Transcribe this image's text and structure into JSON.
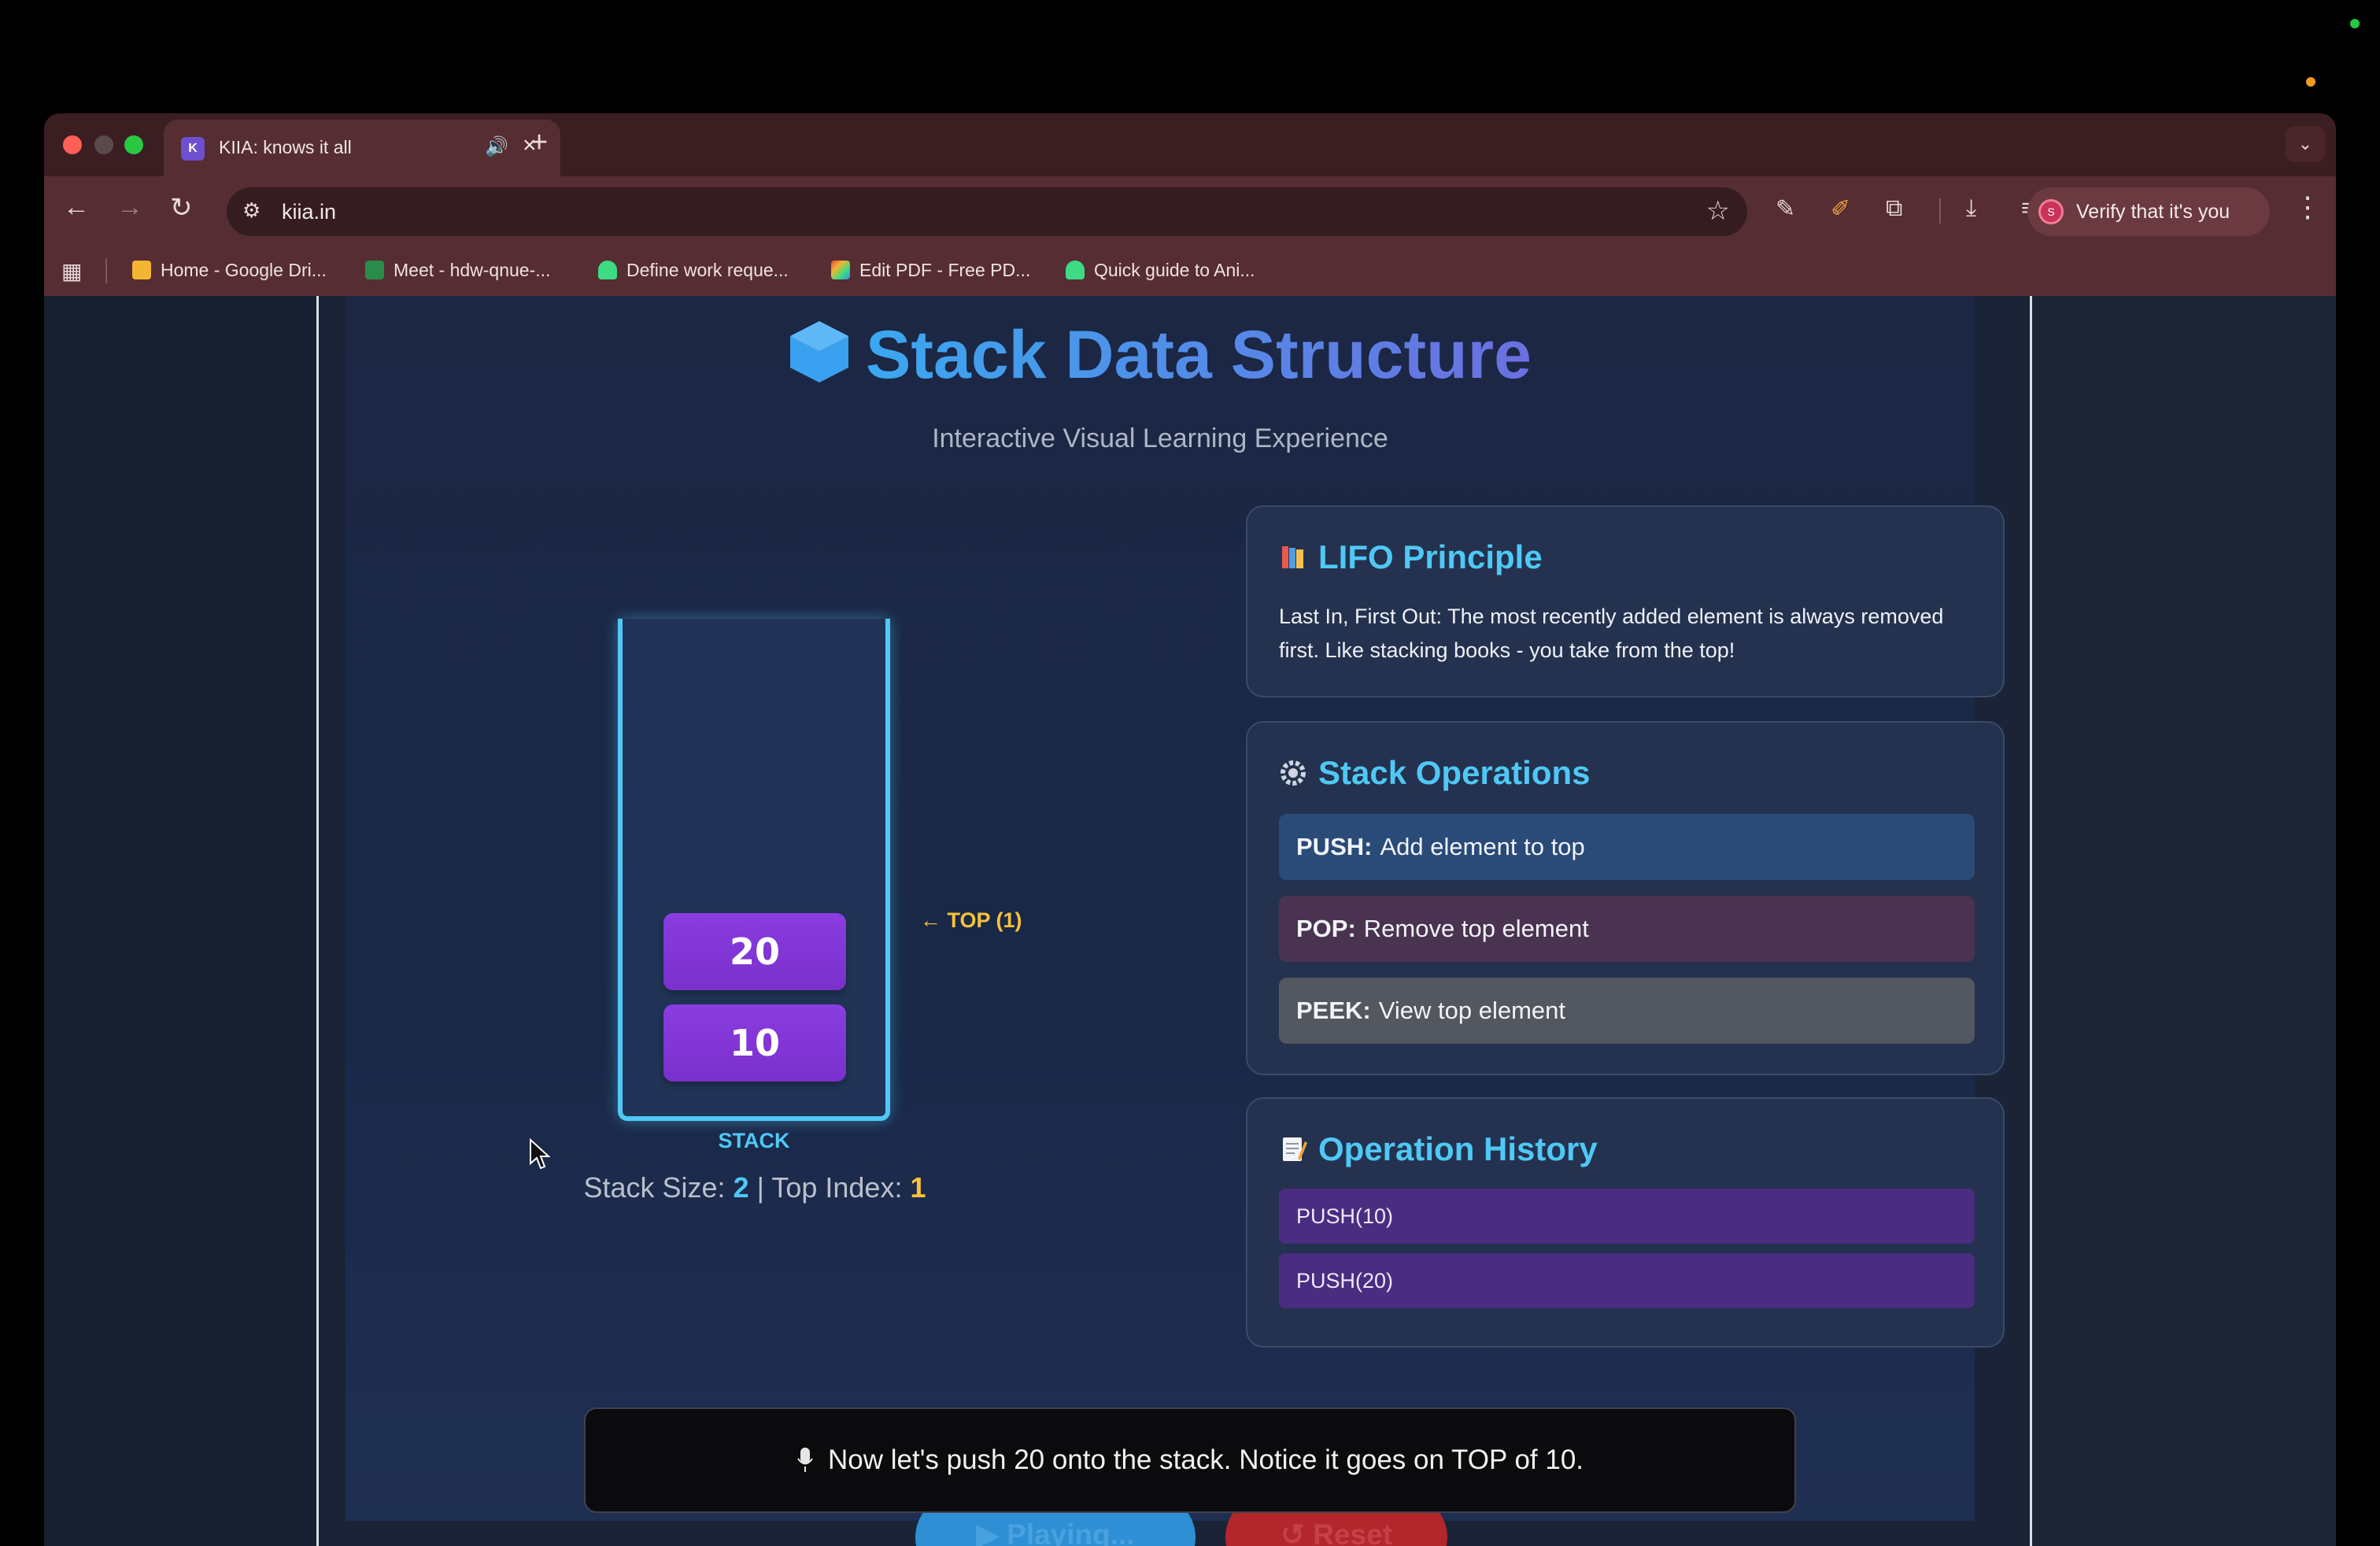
{
  "browser": {
    "tab_title": "KIIA: knows it all",
    "tab_favicon_text": "K",
    "url": "kiia.in",
    "verify_label": "Verify that it's you",
    "verify_avatar_initial": "S",
    "bookmarks": [
      {
        "label": "Home - Google Dri...",
        "icon": "google-drive-icon",
        "color": "#f2b632"
      },
      {
        "label": "Meet - hdw-qnue-...",
        "icon": "google-meet-icon",
        "color": "#2a8c4a"
      },
      {
        "label": "Define work reque...",
        "icon": "android-icon",
        "color": "#3ddc84"
      },
      {
        "label": "Edit PDF - Free PD...",
        "icon": "pdf-editor-icon",
        "color": "#e8453c"
      },
      {
        "label": "Quick guide to Ani...",
        "icon": "android-icon",
        "color": "#3ddc84"
      }
    ]
  },
  "page": {
    "title": "Stack Data Structure",
    "subtitle": "Interactive Visual Learning Experience",
    "stack_elements": [
      "20",
      "10"
    ],
    "top_pointer": "← TOP (1)",
    "stack_label": "STACK",
    "stack_size_label": "Stack Size:",
    "stack_size": "2",
    "separator": "|",
    "top_index_label": "Top Index:",
    "top_index": "1"
  },
  "lifo": {
    "title": "LIFO Principle",
    "body": "Last In, First Out: The most recently added element is always removed first. Like stacking books - you take from the top!"
  },
  "operations": {
    "title": "Stack Operations",
    "items": [
      {
        "name": "PUSH:",
        "desc": "Add element to top"
      },
      {
        "name": "POP:",
        "desc": "Remove top element"
      },
      {
        "name": "PEEK:",
        "desc": "View top element"
      }
    ]
  },
  "history": {
    "title": "Operation History",
    "items": [
      "PUSH(10)",
      "PUSH(20)"
    ]
  },
  "controls": {
    "play_label": "▶ Playing...",
    "reset_label": "↺ Reset"
  },
  "caption": "Now let's push 20 onto the stack. Notice it goes on TOP of 10.",
  "colors": {
    "accent_cyan": "#4fc8f5",
    "accent_yellow": "#f6c23a",
    "stack_purple": "#8a3ce0"
  }
}
